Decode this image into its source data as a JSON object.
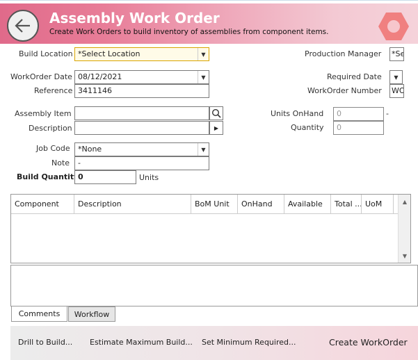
{
  "header": {
    "title": "Assembly Work Order",
    "subtitle": "Create Work Orders to build inventory of assemblies from component items.",
    "gradient_start": "#e06a8a",
    "hex_icon_color": "#f08080"
  },
  "form": {
    "build_location": {
      "label": "Build Location",
      "value": "*Select Location"
    },
    "production_manager": {
      "label": "Production Manager",
      "value": "*Se"
    },
    "workorder_date": {
      "label": "WorkOrder Date",
      "value": "08/12/2021"
    },
    "required_date": {
      "label": "Required Date",
      "value": ""
    },
    "reference": {
      "label": "Reference",
      "value": "3411146"
    },
    "workorder_number": {
      "label": "WorkOrder Number",
      "value": "WO"
    },
    "assembly_item": {
      "label": "Assembly Item",
      "value": ""
    },
    "units_onhand": {
      "label": "Units OnHand",
      "value": "0",
      "suffix": "-"
    },
    "description": {
      "label": "Description",
      "value": ""
    },
    "quantity": {
      "label": "Quantity",
      "value": "0"
    },
    "job_code": {
      "label": "Job Code",
      "value": "*None"
    },
    "note": {
      "label": "Note",
      "value": "-"
    },
    "build_quantity": {
      "label": "Build Quantity",
      "value": "0",
      "unit": "Units"
    }
  },
  "grid": {
    "columns": [
      "Component",
      "Description",
      "BoM Unit",
      "OnHand",
      "Available",
      "Total ...",
      "UoM"
    ]
  },
  "tabs": [
    "Comments",
    "Workflow"
  ],
  "footer": {
    "drill": "Drill to Build...",
    "estimate": "Estimate Maximum Build...",
    "set_min": "Set Minimum Required...",
    "create": "Create WorkOrder"
  }
}
